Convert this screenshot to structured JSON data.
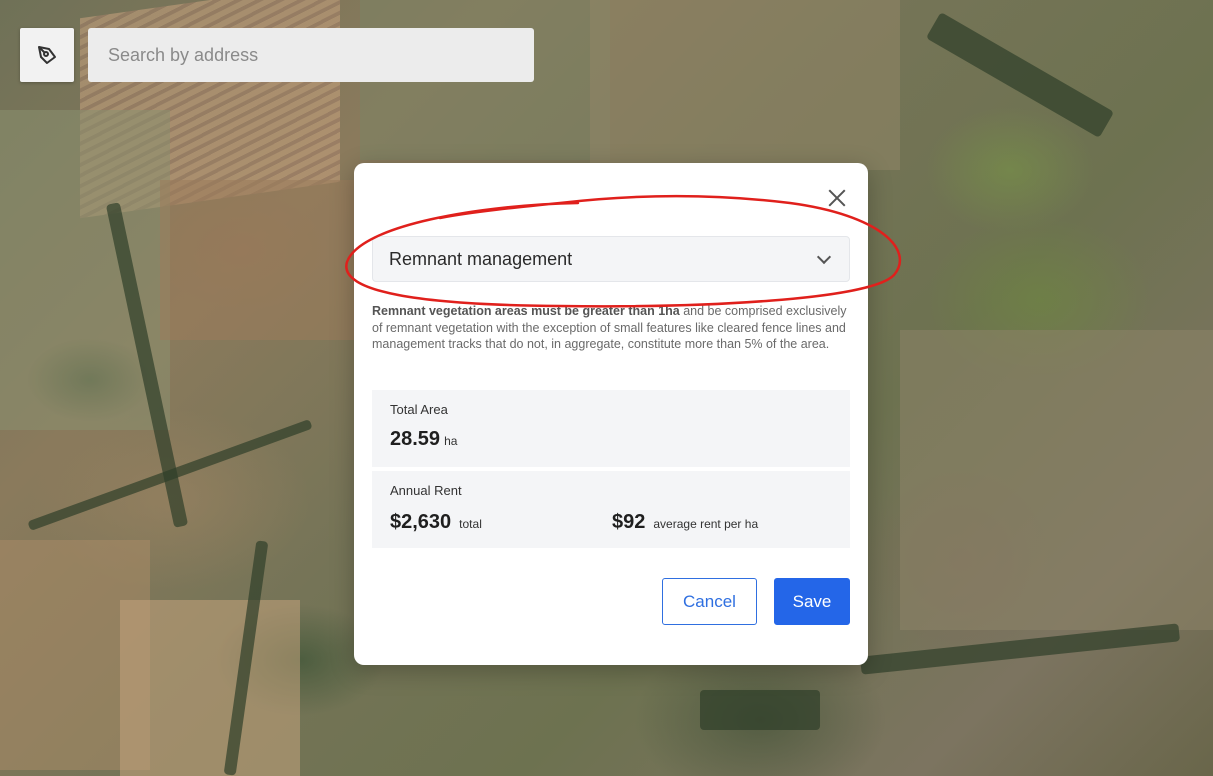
{
  "map": {
    "draw_tool_icon": "draw-polygon-icon",
    "search": {
      "placeholder": "Search by address",
      "value": ""
    }
  },
  "modal": {
    "close_icon": "close-icon",
    "select": {
      "value": "Remnant management",
      "chevron_icon": "chevron-down-icon"
    },
    "description": {
      "bold": "Remnant vegetation areas must be greater than 1ha",
      "text": " and be comprised exclusively of remnant vegetation with the exception of small features like cleared fence lines and management tracks that do not, in aggregate, constitute more than 5% of the area."
    },
    "total_area": {
      "label": "Total Area",
      "value": "28.59",
      "unit": "ha"
    },
    "annual_rent": {
      "label": "Annual Rent",
      "total_value": "$2,630",
      "total_unit": "total",
      "avg_value": "$92",
      "avg_unit": "average rent per ha"
    },
    "buttons": {
      "cancel": "Cancel",
      "save": "Save"
    }
  },
  "colors": {
    "primary": "#2466e8",
    "annotation": "#e0201c"
  }
}
